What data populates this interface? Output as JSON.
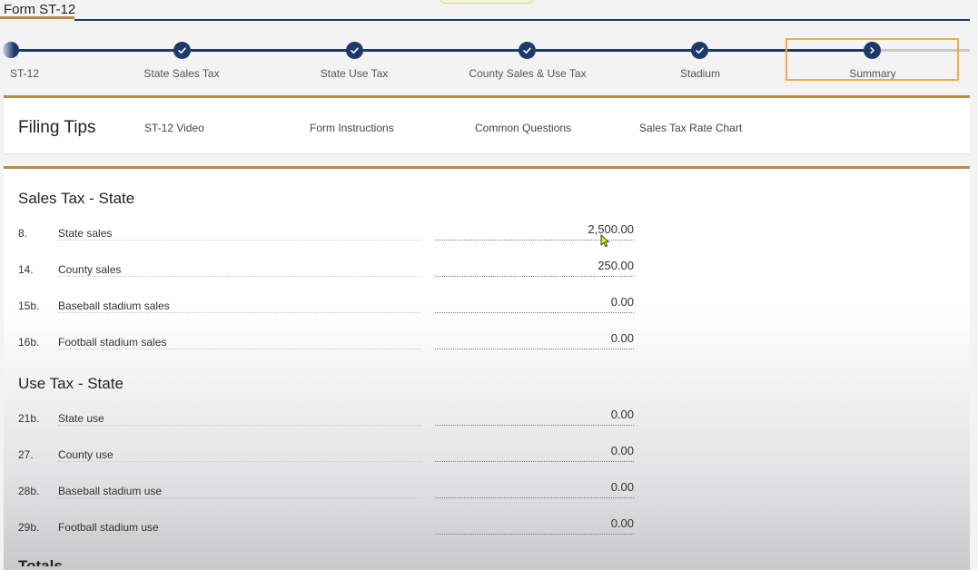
{
  "form": {
    "title": "Form ST-12"
  },
  "stepper": {
    "steps": [
      {
        "label": "ST-12",
        "state": "partial"
      },
      {
        "label": "State Sales Tax",
        "state": "complete",
        "icon": "check-icon"
      },
      {
        "label": "State Use Tax",
        "state": "complete",
        "icon": "check-icon"
      },
      {
        "label": "County Sales & Use Tax",
        "state": "complete",
        "icon": "check-icon"
      },
      {
        "label": "Stadium",
        "state": "complete",
        "icon": "check-icon"
      },
      {
        "label": "Summary",
        "state": "current",
        "icon": "chevron-right-icon"
      }
    ],
    "highlight_color": "#f5a843",
    "accent_color": "#1b3a6b"
  },
  "filing_tips": {
    "title": "Filing Tips",
    "links": [
      "ST-12 Video",
      "Form Instructions",
      "Common Questions",
      "Sales Tax Rate Chart"
    ]
  },
  "sales_tax_state": {
    "title": "Sales Tax - State",
    "rows": [
      {
        "line": "8.",
        "label": "State sales",
        "value": "2,500.00"
      },
      {
        "line": "14.",
        "label": "County sales",
        "value": "250.00"
      },
      {
        "line": "15b.",
        "label": "Baseball stadium sales",
        "value": "0.00"
      },
      {
        "line": "16b.",
        "label": "Football stadium sales",
        "value": "0.00"
      }
    ]
  },
  "use_tax_state": {
    "title": "Use Tax - State",
    "rows": [
      {
        "line": "21b.",
        "label": "State use",
        "value": "0.00"
      },
      {
        "line": "27.",
        "label": "County use",
        "value": "0.00"
      },
      {
        "line": "28b.",
        "label": "Baseball stadium use",
        "value": "0.00"
      },
      {
        "line": "29b.",
        "label": "Football stadium use",
        "value": "0.00"
      }
    ]
  },
  "totals": {
    "title": "Totals"
  },
  "colors": {
    "gold_accent": "#b88a48",
    "navy": "#1b3a6b"
  }
}
